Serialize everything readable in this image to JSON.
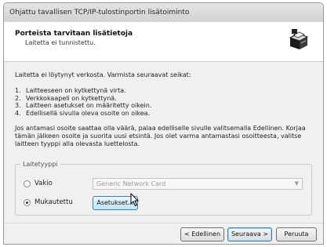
{
  "window": {
    "title": "Ohjattu tavallisen TCP/IP-tulostinportin lisätoiminto"
  },
  "header": {
    "title": "Porteista tarvitaan lisätietoja",
    "subtitle": "Laitetta ei tunnistettu."
  },
  "body": {
    "intro": "Laitetta ei löytynyt verkosta. Varmista seuraavat seikat:",
    "steps": [
      {
        "num": "1.",
        "text": "Laitteeseen on kytkettynä virta."
      },
      {
        "num": "2.",
        "text": "Verkkokaapeli on kytkettynä."
      },
      {
        "num": "3.",
        "text": "Laitteen asetukset on määritetty oikein."
      },
      {
        "num": "4.",
        "text": "Edellisellä sivulla oleva osoite on oikea."
      }
    ],
    "note": "Jos antamasi osoite saattaa olla väärä, palaa edelliselle sivulle valitsemalla Edellinen. Korjaa tämän jälkeen osoite ja suorita uusi etsintä. Jos olet varma antamastasi osoitteesta, valitse laitteen tyyppi alla olevasta luettelosta."
  },
  "device_type": {
    "group_label": "Laitetyyppi",
    "standard_label": "Vakio",
    "standard_selected": false,
    "standard_value": "Generic Network Card",
    "custom_label": "Mukautettu",
    "custom_selected": true,
    "settings_button": "Asetukset..."
  },
  "footer": {
    "back_button": "< Edellinen",
    "next_button": "Seuraava >",
    "cancel_button": "Peruuta"
  },
  "icons": {
    "header_icon": "network-printer-icon",
    "cursor": "mouse-pointer-icon"
  }
}
